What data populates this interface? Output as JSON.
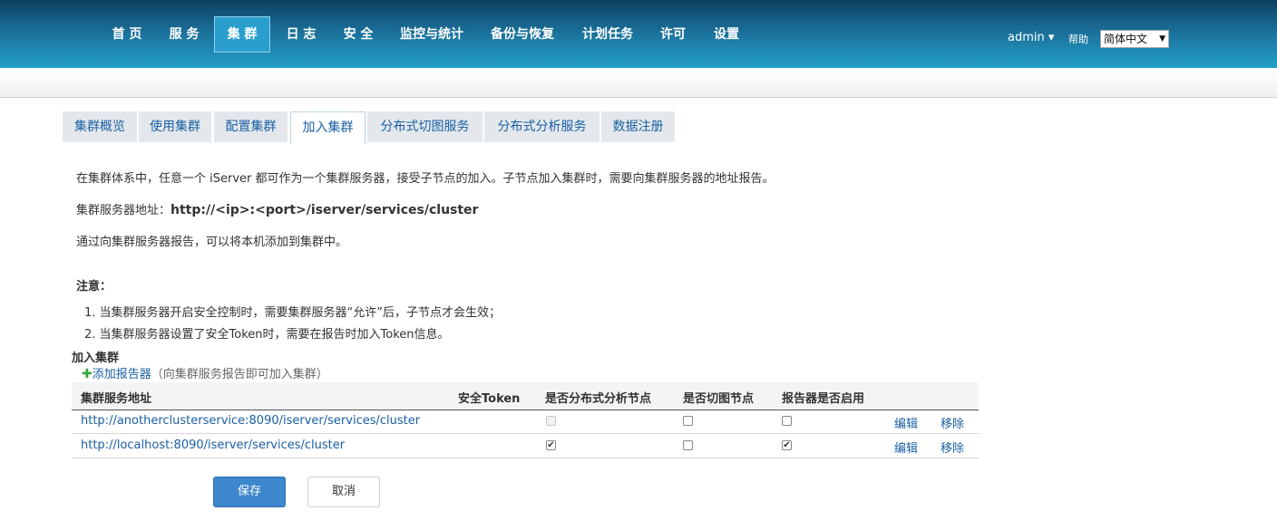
{
  "nav": {
    "items": [
      {
        "label": "首 页"
      },
      {
        "label": "服 务"
      },
      {
        "label": "集 群"
      },
      {
        "label": "日 志"
      },
      {
        "label": "安 全"
      },
      {
        "label": "监控与统计"
      },
      {
        "label": "备份与恢复"
      },
      {
        "label": "计划任务"
      },
      {
        "label": "许可"
      },
      {
        "label": "设置"
      }
    ],
    "active": "集 群",
    "user": "admin ▾",
    "help": "帮助",
    "language": "简体中文"
  },
  "tabs": {
    "items": [
      {
        "label": "集群概览"
      },
      {
        "label": "使用集群"
      },
      {
        "label": "配置集群"
      },
      {
        "label": "加入集群"
      },
      {
        "label": "分布式切图服务"
      },
      {
        "label": "分布式分析服务"
      },
      {
        "label": "数据注册"
      }
    ],
    "active": "加入集群"
  },
  "content": {
    "intro": "在集群体系中，任意一个 iServer 都可作为一个集群服务器，接受子节点的加入。子节点加入集群时，需要向集群服务器的地址报告。",
    "address_label": "集群服务器地址：",
    "address_value": "http://<ip>:<port>/iserver/services/cluster",
    "report_text": "通过向集群服务器报告，可以将本机添加到集群中。",
    "note_title": "注意：",
    "notes": [
      "1. 当集群服务器开启安全控制时，需要集群服务器“允许”后，子节点才会生效；",
      "2. 当集群服务器设置了安全Token时，需要在报告时加入Token信息。"
    ],
    "join_title": "加入集群",
    "add_reporter_label": "添加报告器",
    "add_reporter_hint": "（向集群服务报告即可加入集群）"
  },
  "table": {
    "headers": [
      "集群服务地址",
      "安全Token",
      "是否分布式分析节点",
      "是否切图节点",
      "报告器是否启用"
    ],
    "rows": [
      {
        "address": "http://anotherclusterservice:8090/iserver/services/cluster",
        "token": "",
        "analyst": false,
        "analyst_disabled": true,
        "tile": false,
        "enabled": false,
        "edit": "编辑",
        "remove": "移除"
      },
      {
        "address": "http://localhost:8090/iserver/services/cluster",
        "token": "",
        "analyst": true,
        "analyst_disabled": false,
        "tile": false,
        "enabled": true,
        "edit": "编辑",
        "remove": "移除"
      }
    ]
  },
  "actions": {
    "save": "保存",
    "cancel": "取消"
  },
  "colors": {
    "nav_dark": "#0f3f61",
    "nav_light": "#23a0c9",
    "link": "#1a5fa5",
    "primary_button": "#3d87cc"
  }
}
